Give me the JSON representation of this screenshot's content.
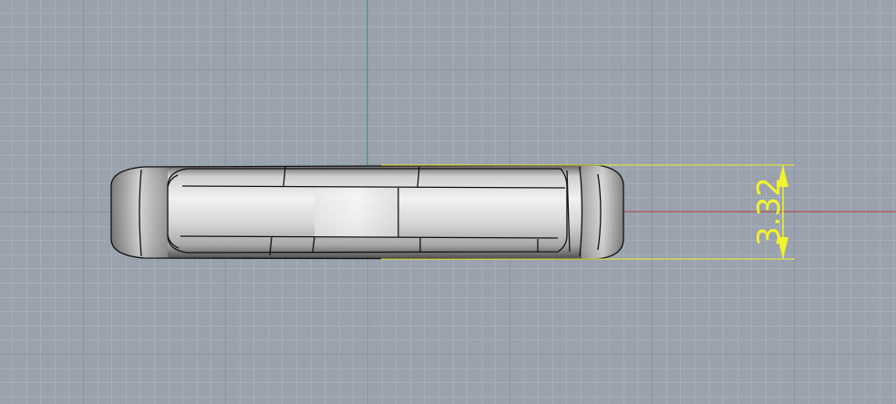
{
  "viewport": {
    "view": "front",
    "background_color": "#9aa3ad",
    "grid_minor_color": "#a6aeb7",
    "grid_major_color": "#8b939c",
    "x_axis_color": "#b04a3c",
    "z_axis_color": "#3f9a55"
  },
  "ring_model": {
    "type": "band-ring",
    "view": "side-profile",
    "outline_color": "#111111"
  },
  "dimension": {
    "value_label": "3.32",
    "type": "linear-vertical",
    "color": "#f2f22e"
  }
}
